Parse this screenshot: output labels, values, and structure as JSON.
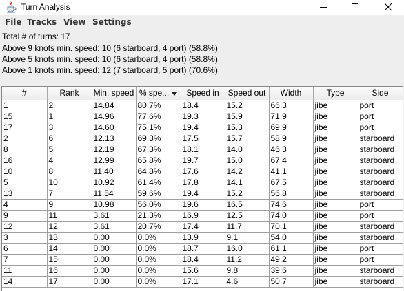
{
  "window": {
    "title": "Turn Analysis",
    "icons": {
      "app": "java-cup-icon",
      "minimize": "minimize-icon",
      "maximize": "maximize-icon",
      "close": "close-icon"
    }
  },
  "menu": {
    "file": "File",
    "tracks": "Tracks",
    "view": "View",
    "settings": "Settings"
  },
  "stats": [
    "Total # of turns: 17",
    "Above 9 knots min. speed: 10 (6 starboard, 4 port) (58.8%)",
    "Above 5 knots min. speed: 10 (6 starboard, 4 port) (58.8%)",
    "Above 1 knots min. speed: 12 (7 starboard, 5 port) (70.6%)"
  ],
  "table": {
    "sorted_column": "% spe...",
    "sort_direction": "descending",
    "headers": [
      "#",
      "Rank",
      "Min. speed",
      "% spe...",
      "Speed in",
      "Speed out",
      "Width",
      "Type",
      "Side"
    ],
    "rows": [
      [
        "1",
        "2",
        "14.84",
        "80.7%",
        "18.4",
        "15.2",
        "66.3",
        "jibe",
        "port"
      ],
      [
        "15",
        "1",
        "14.96",
        "77.6%",
        "19.3",
        "15.9",
        "71.9",
        "jibe",
        "port"
      ],
      [
        "17",
        "3",
        "14.60",
        "75.1%",
        "19.4",
        "15.3",
        "69.9",
        "jibe",
        "port"
      ],
      [
        "2",
        "6",
        "12.13",
        "69.3%",
        "17.5",
        "15.7",
        "58.9",
        "jibe",
        "starboard"
      ],
      [
        "8",
        "5",
        "12.19",
        "67.3%",
        "18.1",
        "14.0",
        "46.3",
        "jibe",
        "starboard"
      ],
      [
        "16",
        "4",
        "12.99",
        "65.8%",
        "19.7",
        "15.0",
        "67.4",
        "jibe",
        "starboard"
      ],
      [
        "10",
        "8",
        "11.40",
        "64.8%",
        "17.6",
        "14.2",
        "41.1",
        "jibe",
        "starboard"
      ],
      [
        "5",
        "10",
        "10.92",
        "61.4%",
        "17.8",
        "14.1",
        "67.5",
        "jibe",
        "starboard"
      ],
      [
        "13",
        "7",
        "11.54",
        "59.6%",
        "19.4",
        "15.2",
        "56.8",
        "jibe",
        "starboard"
      ],
      [
        "4",
        "9",
        "10.98",
        "56.0%",
        "19.6",
        "16.5",
        "74.6",
        "jibe",
        "port"
      ],
      [
        "9",
        "11",
        "3.61",
        "21.3%",
        "16.9",
        "12.5",
        "74.0",
        "jibe",
        "port"
      ],
      [
        "12",
        "12",
        "3.61",
        "20.7%",
        "17.4",
        "11.7",
        "70.1",
        "jibe",
        "starboard"
      ],
      [
        "3",
        "13",
        "0.00",
        "0.0%",
        "13.9",
        "9.1",
        "54.0",
        "jibe",
        "starboard"
      ],
      [
        "6",
        "14",
        "0.00",
        "0.0%",
        "18.7",
        "16.0",
        "61.1",
        "jibe",
        "port"
      ],
      [
        "7",
        "15",
        "0.00",
        "0.0%",
        "18.4",
        "11.2",
        "49.2",
        "jibe",
        "port"
      ],
      [
        "11",
        "16",
        "0.00",
        "0.0%",
        "15.6",
        "9.8",
        "39.6",
        "jibe",
        "starboard"
      ],
      [
        "14",
        "17",
        "0.00",
        "0.0%",
        "17.1",
        "4.6",
        "50.7",
        "jibe",
        "starboard"
      ]
    ]
  }
}
